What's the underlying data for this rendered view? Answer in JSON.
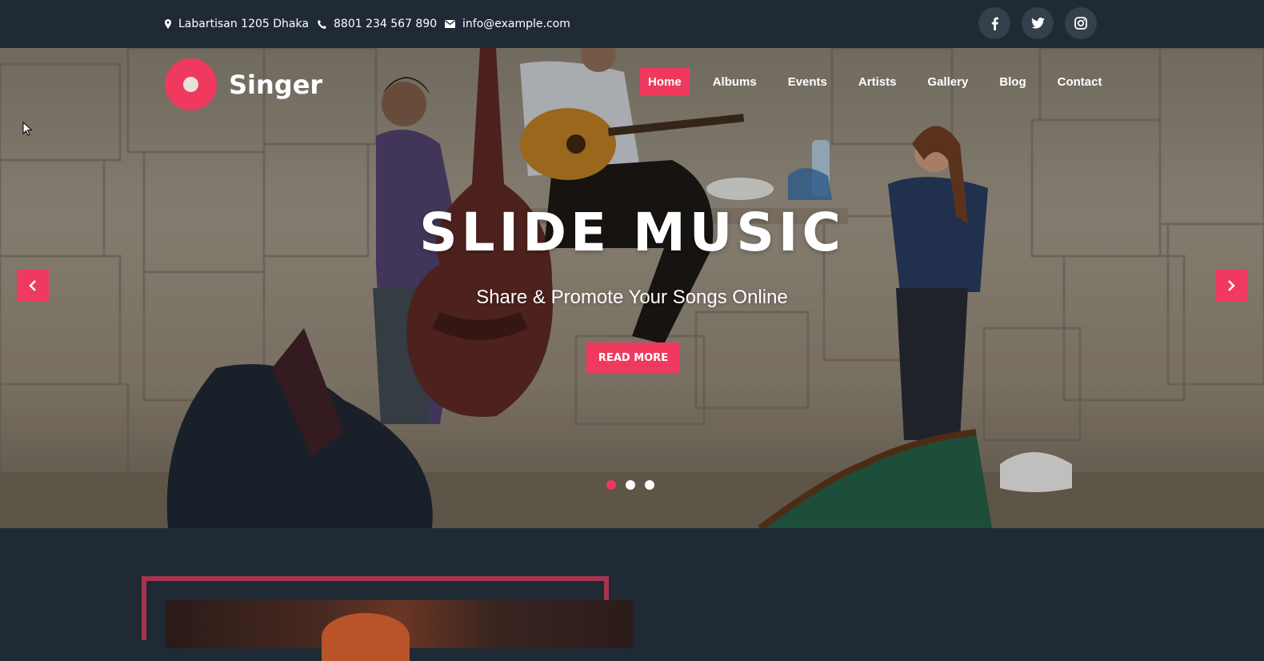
{
  "topbar": {
    "address": "Labartisan 1205 Dhaka",
    "phone": "8801 234 567 890",
    "email": "info@example.com",
    "social_icons": [
      "facebook-icon",
      "twitter-icon",
      "instagram-icon"
    ]
  },
  "header": {
    "logo_text": "Singer",
    "nav": [
      {
        "label": "Home",
        "active": true
      },
      {
        "label": "Albums"
      },
      {
        "label": "Events"
      },
      {
        "label": "Artists"
      },
      {
        "label": "Gallery"
      },
      {
        "label": "Blog"
      },
      {
        "label": "Contact"
      }
    ]
  },
  "slider": {
    "title": "SLIDE MUSIC",
    "subtitle": "Share & Promote Your Songs Online",
    "button_label": "READ MORE",
    "dots": 3,
    "active_dot": 1
  },
  "colors": {
    "accent": "#f0395e",
    "dark_bg": "#1f2a35",
    "social_bg": "#34404c",
    "frame": "#a6344f"
  }
}
